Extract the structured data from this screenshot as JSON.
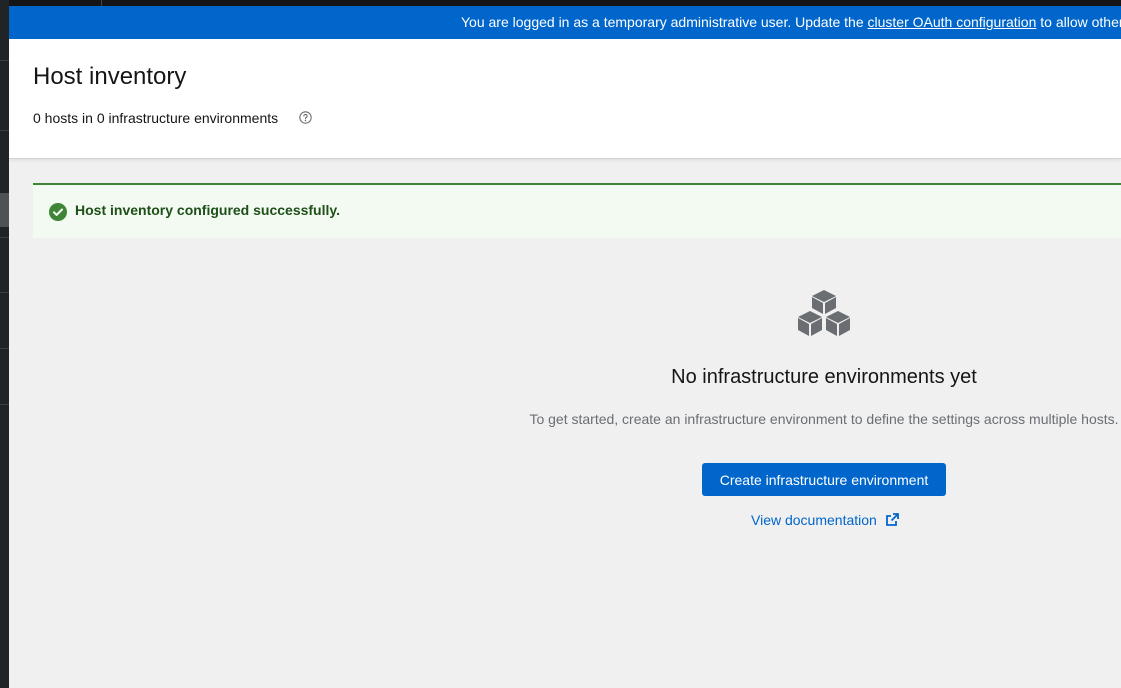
{
  "banner": {
    "text_before": "You are logged in as a temporary administrative user. Update the ",
    "link_text": "cluster OAuth configuration",
    "text_after": " to allow others to log in."
  },
  "header": {
    "title": "Host inventory",
    "subtitle": "0 hosts in 0 infrastructure environments",
    "help_icon": "question-circle-icon"
  },
  "alert": {
    "status": "success",
    "icon": "check-circle-icon",
    "message": "Host inventory configured successfully.",
    "color": "#3e8635"
  },
  "empty_state": {
    "icon": "cubes-icon",
    "title": "No infrastructure environments yet",
    "body": "To get started, create an infrastructure environment to define the settings across multiple hosts.",
    "primary_action": "Create infrastructure environment",
    "secondary_link": "View documentation",
    "secondary_link_icon": "external-link-icon"
  },
  "colors": {
    "accent": "#0066cc",
    "success": "#3e8635",
    "nav_bg": "#212427"
  }
}
